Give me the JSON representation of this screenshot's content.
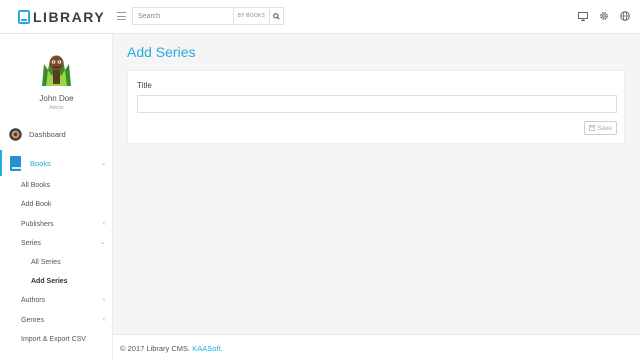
{
  "brand": {
    "name": "LIBRARY",
    "color": "#29a9e1"
  },
  "search": {
    "placeholder": "Search",
    "scope": "BY BOOKS",
    "button_icon": "search-icon"
  },
  "topbar_icons": [
    "monitor-icon",
    "gear-icon",
    "globe-icon"
  ],
  "user": {
    "name": "John Doe",
    "role": "Admin"
  },
  "sidebar": {
    "dashboard": "Dashboard",
    "books": "Books",
    "items": {
      "all_books": "All Books",
      "add_book": "Add Book",
      "publishers": "Publishers",
      "series": "Series",
      "all_series": "All Series",
      "add_series": "Add Series",
      "authors": "Authors",
      "genres": "Genres",
      "import_export": "Import & Export CSV"
    }
  },
  "main": {
    "title": "Add Series",
    "form": {
      "title_label": "Title",
      "title_value": "",
      "save_label": "Save"
    }
  },
  "footer": {
    "text": "© 2017 Library CMS.",
    "link": "KAASoft."
  }
}
